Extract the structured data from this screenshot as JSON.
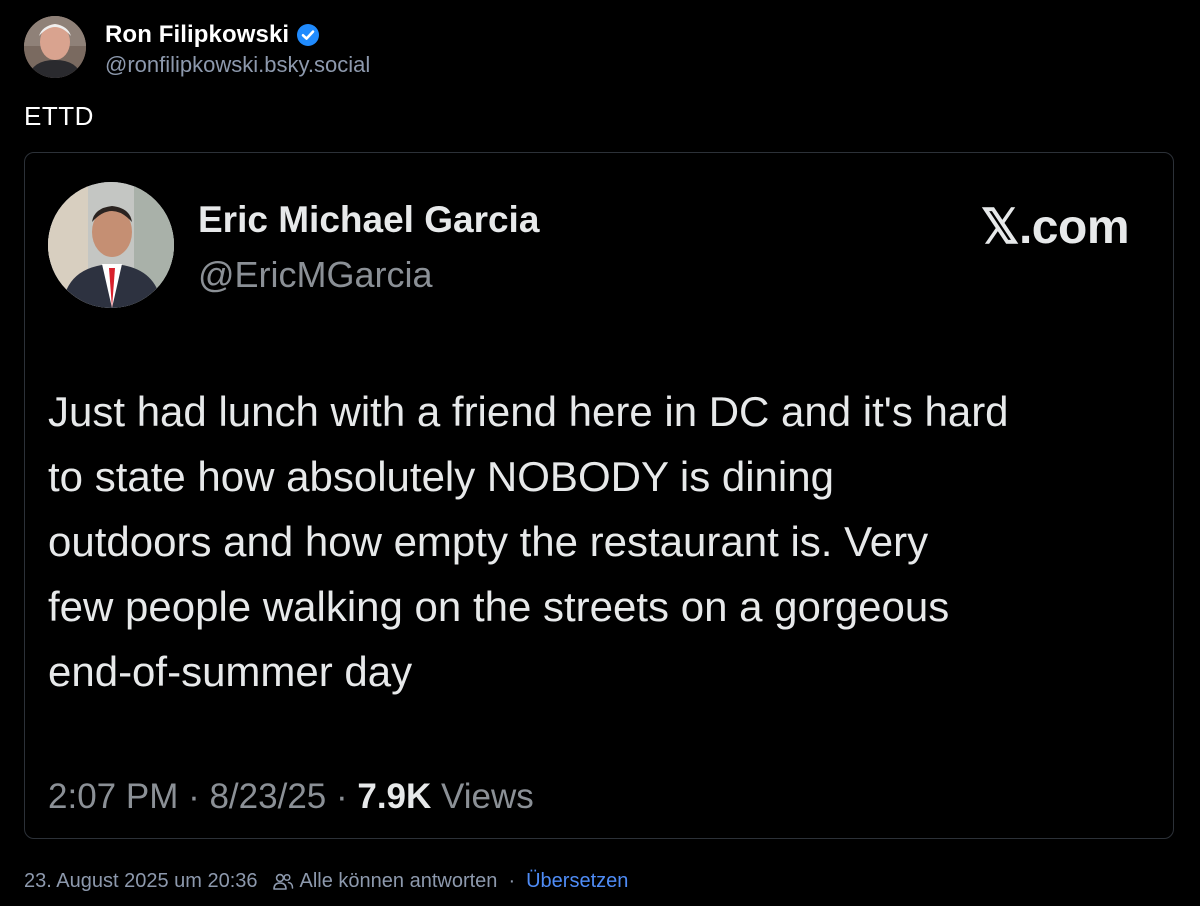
{
  "post": {
    "author": {
      "name": "Ron Filipkowski",
      "handle": "@ronfilipkowski.bsky.social",
      "verified": true,
      "avatar_icon": "profile-photo"
    },
    "text": "ETTD"
  },
  "quoted_post": {
    "author": {
      "name": "Eric Michael Garcia",
      "handle": "@EricMGarcia",
      "avatar_icon": "profile-photo"
    },
    "source": "𝕏.com",
    "text": "Just had lunch with a friend here in DC and it's hard\nto state how absolutely NOBODY is dining\noutdoors and how empty the restaurant is. Very\nfew people walking on the streets on a gorgeous\nend-of-summer day",
    "meta": {
      "time": "2:07 PM",
      "separator": " · ",
      "date": "8/23/25",
      "views_count": "7.9K",
      "views_label": " Views"
    }
  },
  "footer": {
    "timestamp": "23. August 2025 um 20:36",
    "reply_setting": "Alle können antworten",
    "separator": "·",
    "translate_label": "Übersetzen"
  },
  "colors": {
    "background": "#000000",
    "handle_gray": "#8d99ad",
    "verified_blue": "#208bfe",
    "link_blue": "#4f8cf6",
    "embed_border": "#2c3138"
  }
}
